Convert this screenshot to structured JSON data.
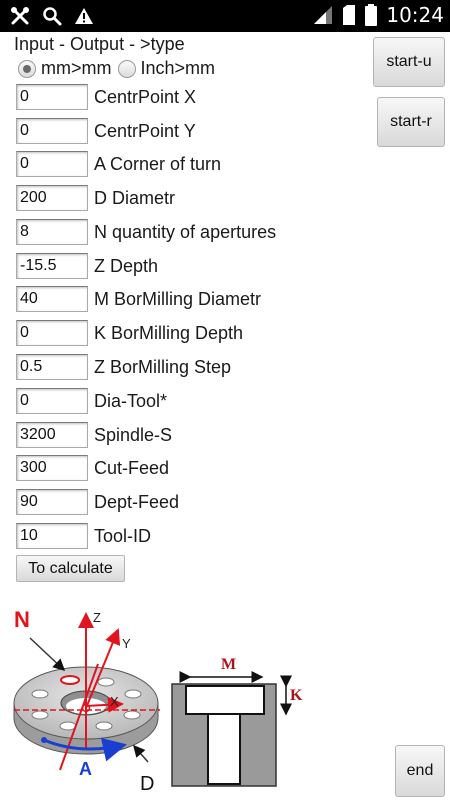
{
  "status_bar": {
    "time": "10:24",
    "left_icons": [
      "tools-icon",
      "search-icon",
      "warning-icon"
    ],
    "right_icons": [
      "signal-icon",
      "sim-icon",
      "battery-icon"
    ]
  },
  "header": {
    "title": "Input - Output - >type",
    "units": {
      "options": [
        "mm>mm",
        "Inch>mm"
      ],
      "selected": "mm>mm"
    }
  },
  "params": [
    {
      "value": "0",
      "label": "CentrPoint X"
    },
    {
      "value": "0",
      "label": "CentrPoint Y"
    },
    {
      "value": "0",
      "label": "A Corner of turn"
    },
    {
      "value": "200",
      "label": "D Diametr"
    },
    {
      "value": "8",
      "label": "N quantity of apertures"
    },
    {
      "value": "-15.5",
      "label": "Z Depth"
    },
    {
      "value": "40",
      "label": "M BorMilling Diametr"
    },
    {
      "value": "0",
      "label": "K BorMilling Depth"
    },
    {
      "value": "0.5",
      "label": "Z BorMilling Step"
    },
    {
      "value": "0",
      "label": "Dia-Tool*"
    },
    {
      "value": "3200",
      "label": "Spindle-S"
    },
    {
      "value": "300",
      "label": "Cut-Feed"
    },
    {
      "value": "90",
      "label": "Dept-Feed"
    },
    {
      "value": "10",
      "label": "Tool-ID"
    }
  ],
  "buttons": {
    "start_u": "start-u",
    "start_r": "start-r",
    "calculate": "To calculate",
    "end": "end"
  },
  "diagram": {
    "labels": {
      "n": "N",
      "z": "Z",
      "y": "Y",
      "x": "X",
      "a": "A",
      "d": "D",
      "m": "M",
      "k": "K"
    },
    "colors": {
      "accent_red": "#e0141e",
      "arrow_blue": "#1a3fd0",
      "dark_red": "#b0101a",
      "section_gray": "#9a9a9a"
    }
  }
}
